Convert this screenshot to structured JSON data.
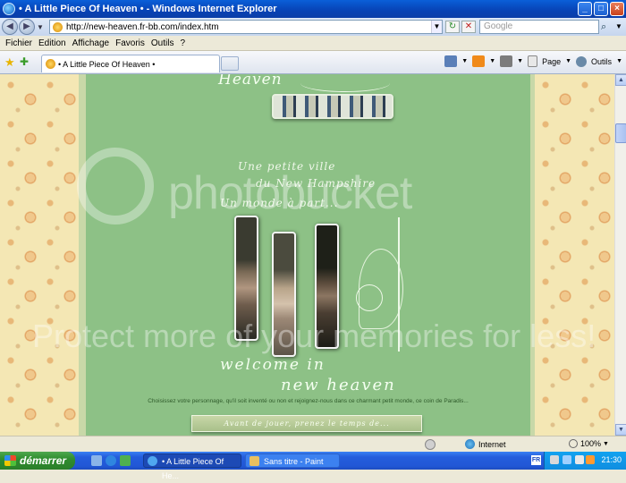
{
  "window": {
    "title": "• A Little Piece Of Heaven • - Windows Internet Explorer",
    "min": "_",
    "max": "□",
    "close": "×"
  },
  "address": {
    "url": "http://new-heaven.fr-bb.com/index.htm",
    "search_placeholder": "Google",
    "search_icon": "magnifier-icon",
    "refresh_label": "↻",
    "stop_label": "✕"
  },
  "menu": [
    "Fichier",
    "Edition",
    "Affichage",
    "Favoris",
    "Outils",
    "?"
  ],
  "tab": {
    "label": "• A Little Piece Of Heaven •"
  },
  "command_bar": {
    "page_label": "Page",
    "tools_label": "Outils"
  },
  "site": {
    "header_script": "Heaven",
    "tagline1": "Une petite ville",
    "tagline2": "du New Hampshire",
    "tagline3": "Un monde à part...",
    "welcome": "welcome in",
    "new_heaven": "new heaven",
    "intro": "Choisissez votre personnage, qu'il soit inventé ou non et rejoignez-nous dans ce charmant petit monde, ce coin de Paradis...",
    "avant_button": "Avant de jouer, prenez le temps de..."
  },
  "watermark": {
    "line1": "photobucket",
    "line2": "Protect more of your memories for less!"
  },
  "status": {
    "zone": "Internet",
    "zoom": "100%"
  },
  "taskbar": {
    "start": "démarrer",
    "tasks": [
      "• A Little Piece Of He...",
      "Sans titre - Paint"
    ],
    "lang": "FR",
    "clock": "21:30"
  }
}
